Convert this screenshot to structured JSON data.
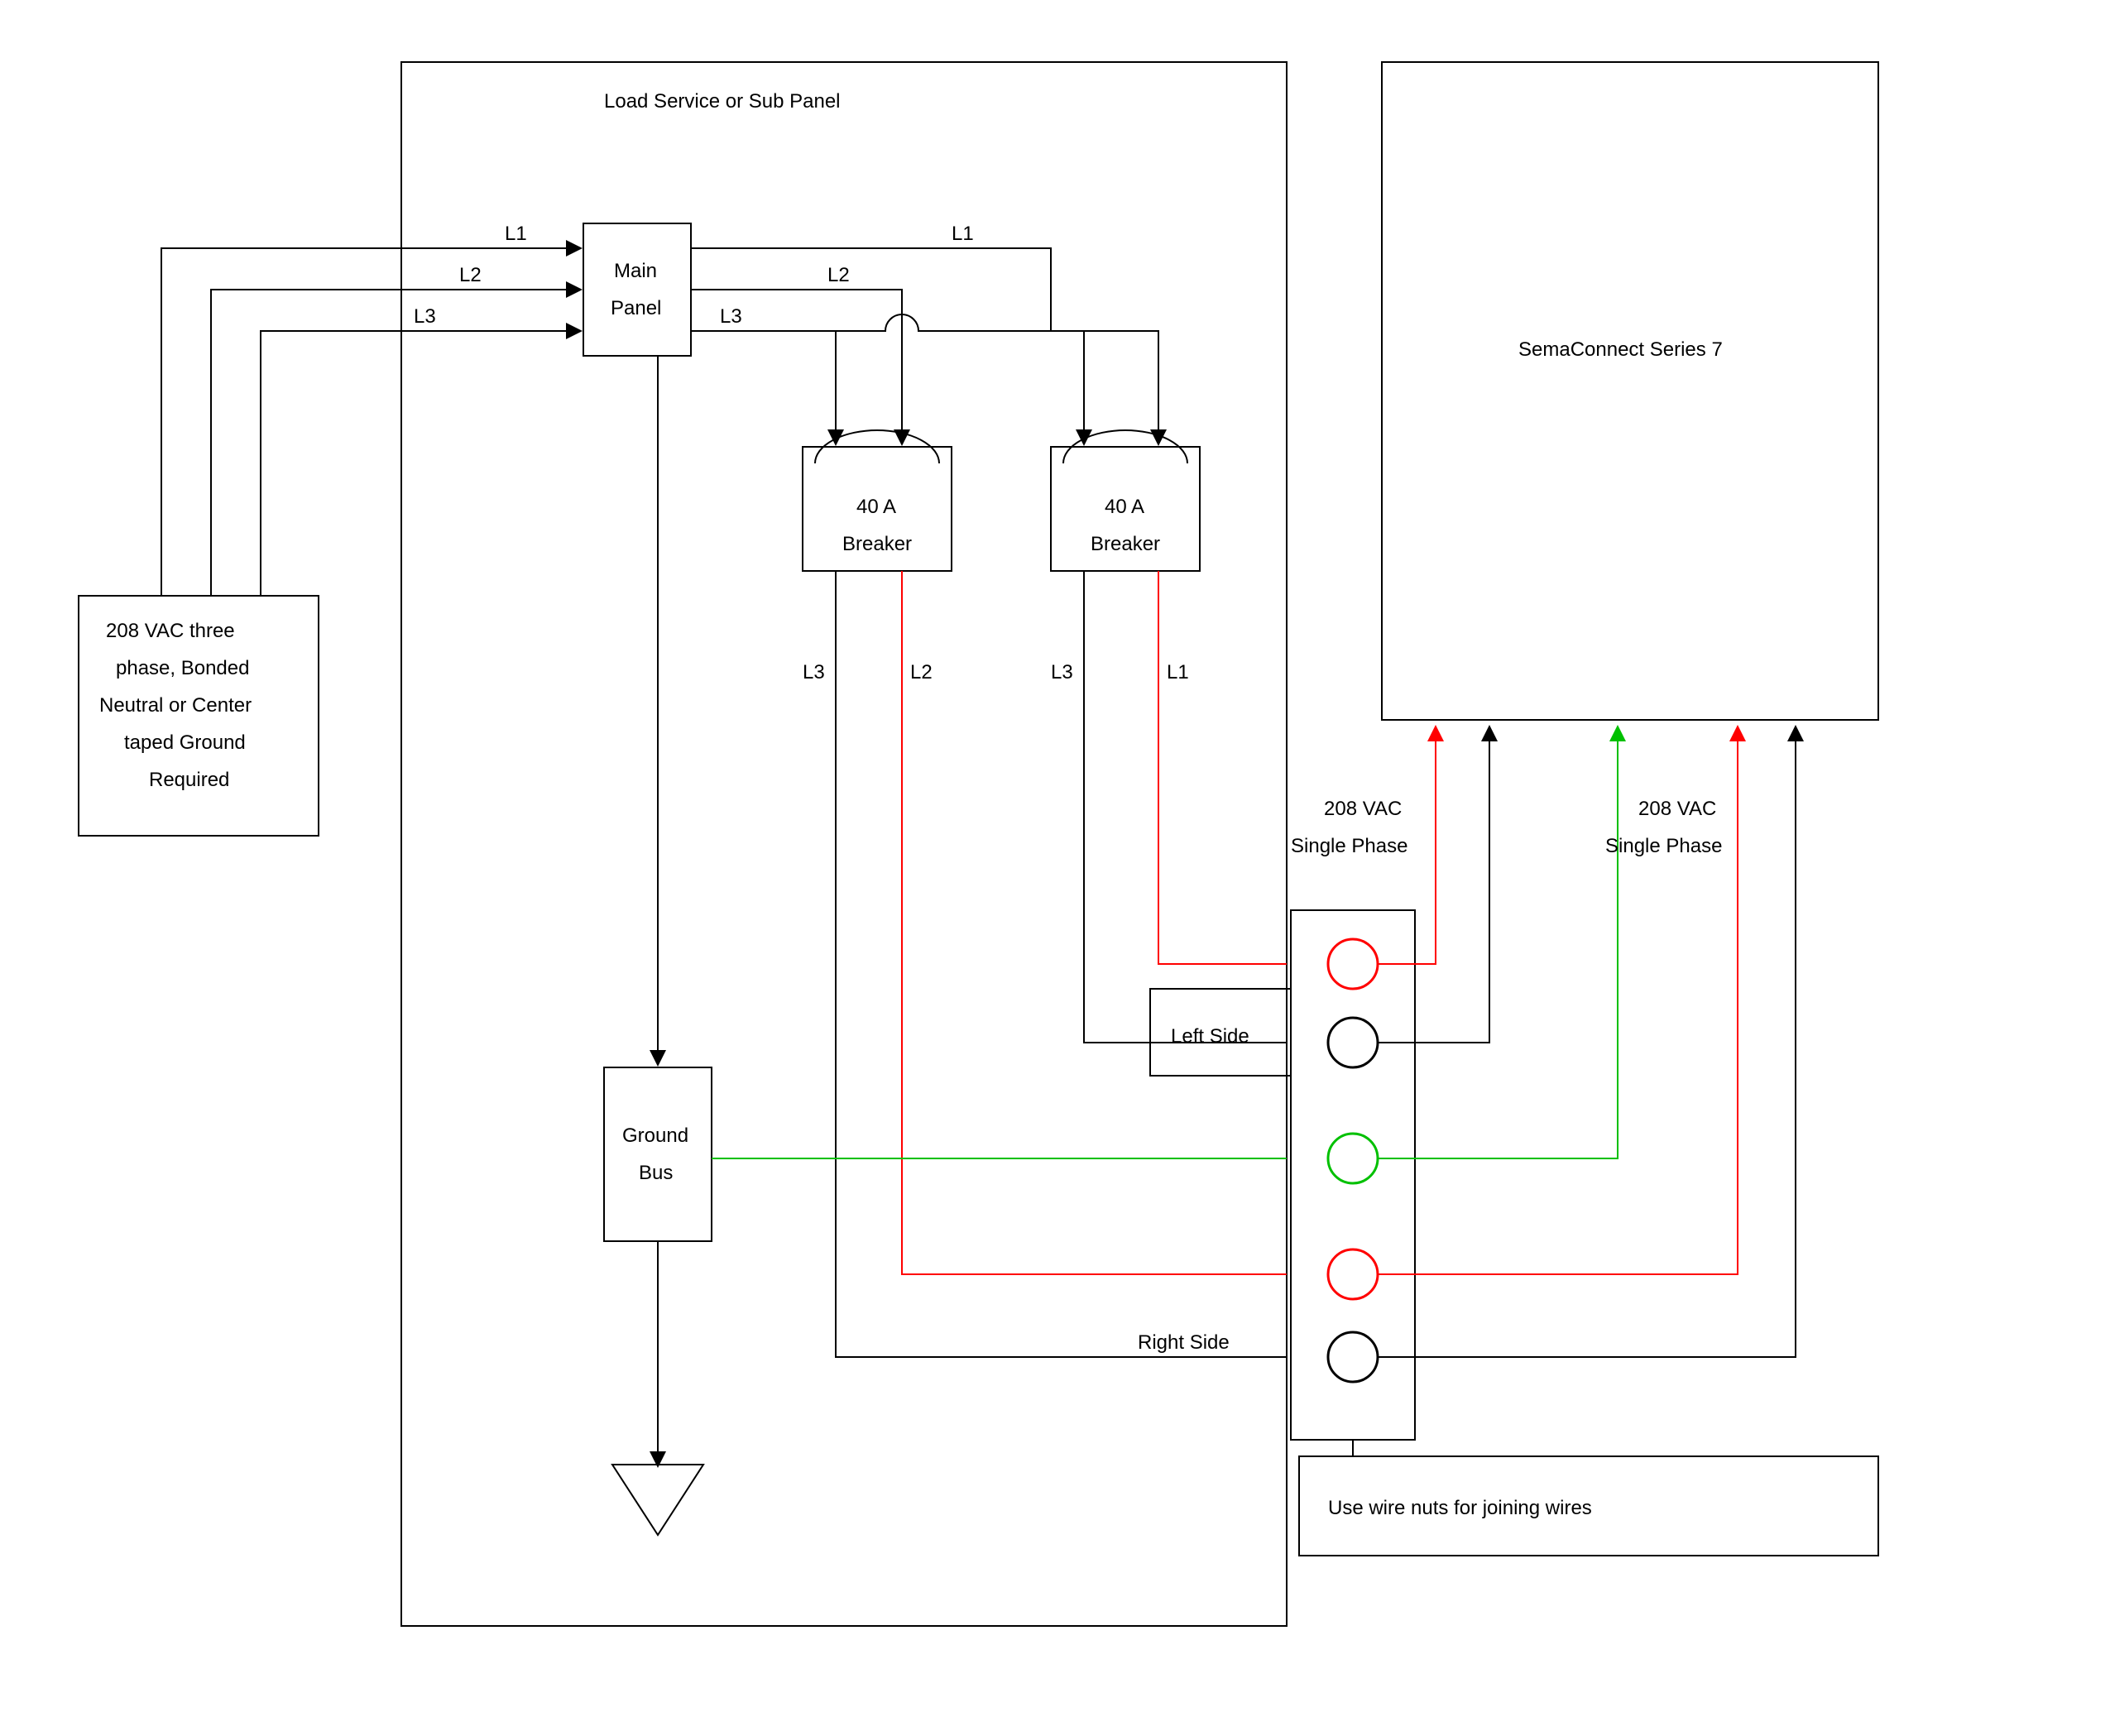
{
  "labels": {
    "panel_title": "Load Service or Sub Panel",
    "source_box": [
      "208 VAC three",
      "phase, Bonded",
      "Neutral or Center",
      "taped Ground",
      "Required"
    ],
    "main_panel": [
      "Main",
      "Panel"
    ],
    "breaker": [
      "40 A",
      "Breaker"
    ],
    "ground_bus": [
      "Ground",
      "Bus"
    ],
    "sema": "SemaConnect Series 7",
    "wire_nuts": "Use wire nuts for joining wires",
    "L1": "L1",
    "L2": "L2",
    "L3": "L3",
    "left_side": "Left Side",
    "right_side": "Right Side",
    "single_phase": [
      "208 VAC",
      "Single Phase"
    ]
  },
  "colors": {
    "red": "#ff0000",
    "green": "#00c000",
    "black": "#000000"
  },
  "diagram": {
    "type": "wiring",
    "description": "Electrical wiring diagram connecting a 208 VAC three-phase bonded-neutral source through a Main Panel and two 40 A breakers to a SemaConnect Series 7 unit. Ground bus feeds the neutral. Wire nuts are used for joining wires on Left Side and Right Side terminal groups."
  }
}
